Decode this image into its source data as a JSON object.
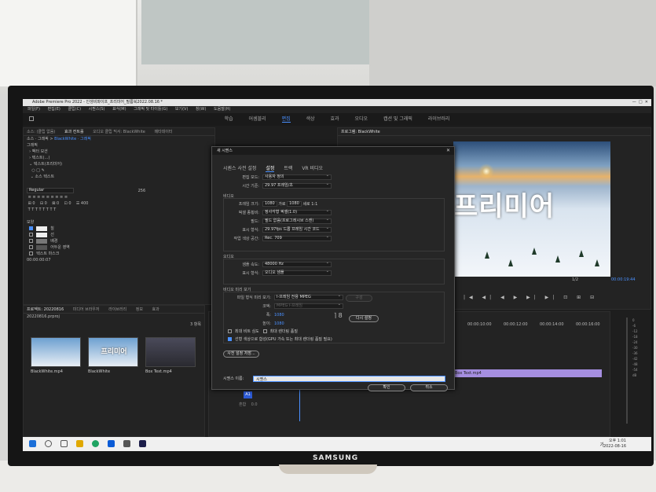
{
  "app": {
    "title": "Adobe Premiere Pro 2022 - 인생비파이프_프리미어_필름북2022.08.16 *",
    "menus": [
      "파일(F)",
      "편집(E)",
      "클립(C)",
      "시퀀스(S)",
      "표식(M)",
      "그래픽 및 타이틀(G)",
      "보기(V)",
      "창(W)",
      "도움말(H)"
    ],
    "workspaces": [
      "학습",
      "어셈블리",
      "편집",
      "색상",
      "효과",
      "오디오",
      "캡션 및 그래픽",
      "라이브러리"
    ],
    "active_workspace": "편집"
  },
  "effect_controls": {
    "tabs": [
      "소스: (클립 없음)",
      "효과 컨트롤",
      "오디오 클립 믹서: BlackWhite",
      "메타데이터"
    ],
    "breadcrumb": [
      "소스 · 그래픽",
      "BlackWhite · 그래픽"
    ],
    "header": "그래픽",
    "items": [
      "벡터 모션",
      "텍스트(…)",
      "텍스트(프리미어)",
      "소스 텍스트"
    ],
    "font_value": "Regular",
    "font_size": "256",
    "appearance_title": "모양",
    "appearance": [
      {
        "label": "칠",
        "checked": true
      },
      {
        "label": "선",
        "checked": false
      },
      {
        "label": "배경",
        "checked": false
      },
      {
        "label": "어두운 영역",
        "checked": false
      },
      {
        "label": "텍스트 마스크",
        "checked": false
      }
    ],
    "time": "00:00:00:07"
  },
  "program": {
    "tab": "프로그램: BlackWhite",
    "overlay_text": "프리미어",
    "timecode": "00:00:19:44",
    "fit": "1/2"
  },
  "project": {
    "tabs": [
      "프로젝트: 20220816",
      "미디어 브라우저",
      "라이브러리",
      "정보",
      "효과"
    ],
    "file": "20220816.prproj",
    "count": "3 항목",
    "clips": [
      {
        "name": "BlackWhite.mp4",
        "overlay": ""
      },
      {
        "name": "BlackWhite",
        "overlay": "프리미어"
      },
      {
        "name": "Box Text.mp4",
        "overlay": ""
      }
    ]
  },
  "timeline": {
    "ruler": [
      "00:00:10:00",
      "00:00:12:00",
      "00:00:14:00",
      "00:00:16:00"
    ],
    "clip": "Box Text.mp4",
    "track": "A1",
    "mix": "혼합",
    "mix_val": "0.0"
  },
  "meter": {
    "ticks": [
      "0",
      "-6",
      "-12",
      "-18",
      "-24",
      "-30",
      "-36",
      "-42",
      "-48",
      "-54",
      "dB"
    ]
  },
  "dialog": {
    "title": "새 시퀀스",
    "tabs": [
      "시퀀스 사전 설정",
      "설정",
      "트랙",
      "VR 비디오"
    ],
    "active_tab": "설정",
    "edit_mode_label": "편집 모드:",
    "edit_mode": "사용자 정의",
    "timebase_label": "시간 기준:",
    "timebase": "29.97 프레임/초",
    "video_title": "비디오",
    "frame_size_label": "프레임 크기:",
    "frame_w": "1080",
    "h_label": "가로",
    "frame_h": "1080",
    "v_label": "세로",
    "ratio": "1:1",
    "pixel_aspect_label": "픽셀 종횡비:",
    "pixel_aspect": "정사각형 픽셀(1.0)",
    "fields_label": "필드:",
    "fields": "필드 없음(프로그레시브 스캔)",
    "display_format_label": "표시 형식:",
    "display_format": "29.97fps 드롭 프레임 시간 코드",
    "color_space_label": "작업 색상 공간:",
    "color_space": "Rec. 709",
    "audio_title": "오디오",
    "sample_rate_label": "샘플 속도:",
    "sample_rate": "48000 Hz",
    "audio_display_label": "표시 형식:",
    "audio_display": "오디오 샘플",
    "preview_title": "비디오 미리 보기",
    "preview_format_label": "파일 형식 미리 보기:",
    "preview_format": "I-프레임 전용 MPEG",
    "config_label": "구성",
    "codec_label": "코덱:",
    "codec": "MPEG I-프레임",
    "width_label": "폭:",
    "width": "1080",
    "height_label": "높이:",
    "height": "1080",
    "reset_label": "다시 설정",
    "max_bit_depth": "최대 비트 심도",
    "max_render_quality": "최대 렌더링 품질",
    "linear_color": "선형 색상으로 합성(GPU 가속 또는 최대 렌더링 품질 필요)",
    "save_preset": "사전 설정 저장...",
    "seq_name_label": "시퀀스 이름:",
    "seq_name": "시퀀스",
    "ok": "확인",
    "cancel": "취소"
  },
  "taskbar": {
    "ime": "가",
    "time": "오후 1:01",
    "date": "2022-08-16"
  },
  "monitor_brand": "SAMSUNG"
}
